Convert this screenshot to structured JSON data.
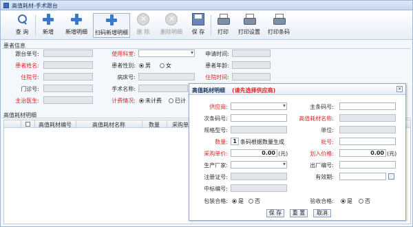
{
  "window": {
    "title": "高值耗材-手术跟台"
  },
  "toolbar": {
    "query": "查 询",
    "add": "新增",
    "add_detail": "新增明细",
    "scan_add_detail": "扫码新增明细",
    "delete": "删 除",
    "delete_detail": "删除明细",
    "save": "保 存",
    "print": "打印",
    "print_settings": "打印设置",
    "print_barcode": "打印条码"
  },
  "patient_info": {
    "section_title": "患者信息",
    "order_no": "跟台单号:",
    "department": "使用科室:",
    "apply_time": "申请时间:",
    "patient_name": "患者姓名:",
    "gender": "患者性别:",
    "gender_male": "男",
    "gender_female": "女",
    "patient_age": "患者年龄:",
    "inpatient_no": "住院号:",
    "bed_no": "病床号:",
    "admission_time": "住院时间:",
    "outpatient_no": "门诊号:",
    "surgery_name": "手术名称:",
    "attending_doctor": "主治医生:",
    "billing": "计费情况:",
    "billing_not": "未计费",
    "billing_done": "已计"
  },
  "grid": {
    "section_title": "高值耗材明细",
    "columns": [
      "高值耗材编号",
      "高值耗材名称",
      "数量",
      "采购单"
    ]
  },
  "dialog": {
    "title": "高值耗材明细",
    "hint": "(请先选择供应商)",
    "close": "×",
    "supplier": "供应商:",
    "main_barcode": "主条码号:",
    "sub_barcode": "次条码号:",
    "item_name": "高值耗材名称:",
    "spec": "规格型号:",
    "unit": "单位:",
    "quantity": "数量:",
    "quantity_value": "1",
    "quantity_note": "条码根据数量生成",
    "batch_no": "批号:",
    "purchase_price": "采购单价:",
    "purchase_price_value": "0.00",
    "yuan": "(元)",
    "transfer_price": "划入价格:",
    "transfer_price_value": "0.00",
    "manufacturer": "生产厂家:",
    "factory_no": "出厂编号:",
    "reg_cert": "注册证号:",
    "expiry": "有效期:",
    "bid_no": "中标编号:",
    "package_ok": "包装合格:",
    "inspect_ok": "验收合格:",
    "yes": "是",
    "no": "否",
    "save_btn": "保 存",
    "reset_btn": "重 置",
    "cancel_btn": "取消"
  },
  "colors": {
    "required": "#d82a2a",
    "accent": "#3b78c7"
  }
}
